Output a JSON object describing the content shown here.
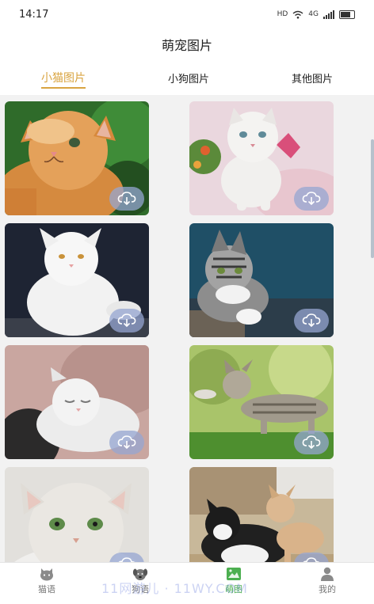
{
  "status": {
    "time": "14:17",
    "hd": "HD",
    "net": "4G"
  },
  "header": {
    "title": "萌宠图片"
  },
  "tabs": [
    {
      "label": "小猫图片",
      "active": true
    },
    {
      "label": "小狗图片",
      "active": false
    },
    {
      "label": "其他图片",
      "active": false
    }
  ],
  "grid": {
    "download_icon": "cloud-download-icon",
    "items": [
      {
        "name": "orange-kitten"
      },
      {
        "name": "white-kitten-flowers"
      },
      {
        "name": "white-persian-cat"
      },
      {
        "name": "tabby-kitten-teal"
      },
      {
        "name": "sleeping-kitten"
      },
      {
        "name": "tabby-kitten-grass"
      },
      {
        "name": "cream-kitten"
      },
      {
        "name": "black-white-cat-pair"
      }
    ]
  },
  "bottom_nav": [
    {
      "label": "猫语",
      "icon": "cat-icon",
      "active": false
    },
    {
      "label": "狗语",
      "icon": "dog-icon",
      "active": false
    },
    {
      "label": "萌图",
      "icon": "image-icon",
      "active": true
    },
    {
      "label": "我的",
      "icon": "user-icon",
      "active": false
    }
  ],
  "watermark": "11网游儿 · 11WY.COM",
  "colors": {
    "accent_tab": "#d9a441",
    "nav_active": "#4caf50"
  }
}
